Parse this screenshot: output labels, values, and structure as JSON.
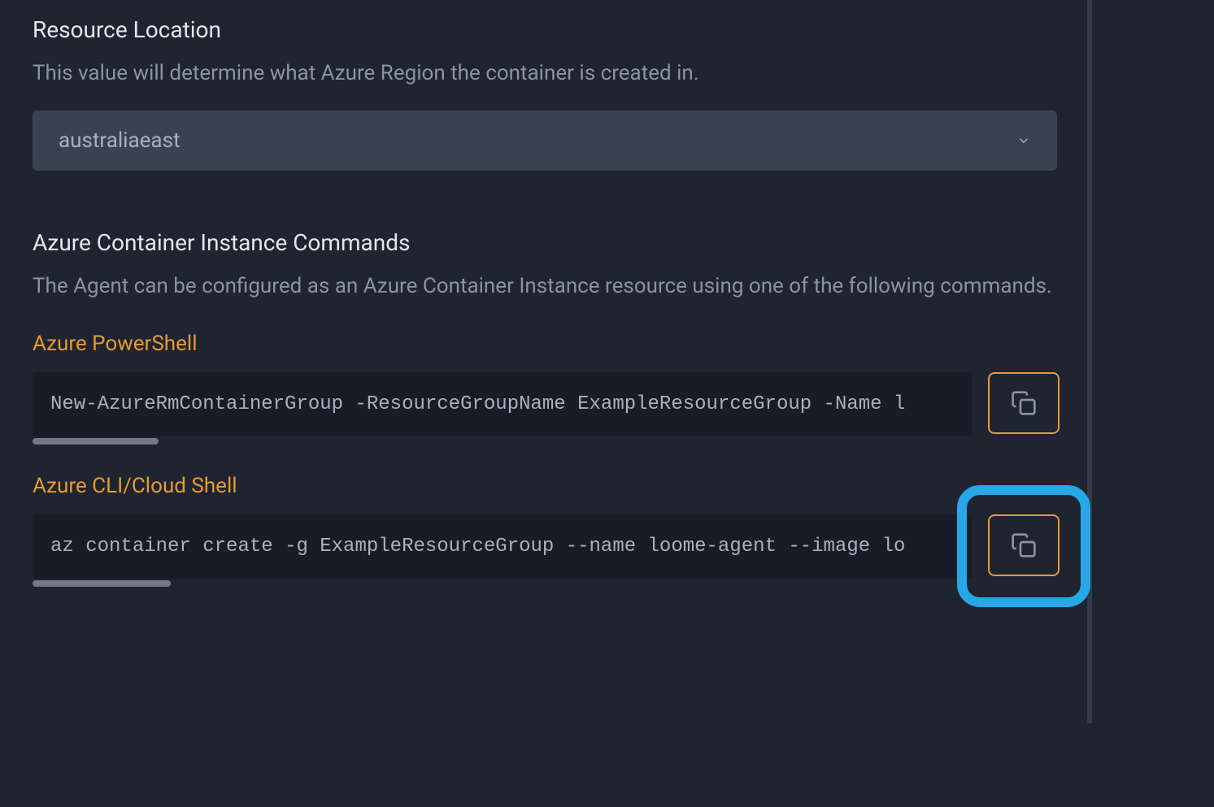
{
  "resource_location": {
    "title": "Resource Location",
    "description": "This value will determine what Azure Region the container is created in.",
    "selected_value": "australiaeast"
  },
  "commands_section": {
    "title": "Azure Container Instance Commands",
    "description": "The Agent can be configured as an Azure Container Instance resource using one of the following commands.",
    "powershell": {
      "heading": "Azure PowerShell",
      "command": "New-AzureRmContainerGroup -ResourceGroupName ExampleResourceGroup -Name l"
    },
    "cli": {
      "heading": "Azure CLI/Cloud Shell",
      "command": "az container create -g ExampleResourceGroup --name loome-agent --image lo"
    }
  }
}
